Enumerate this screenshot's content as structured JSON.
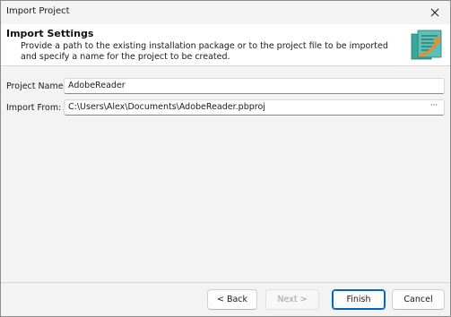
{
  "window": {
    "title": "Import Project",
    "close_icon": "close-icon"
  },
  "header": {
    "title": "Import Settings",
    "description": "Provide a path to the existing installation package or to the project file to be imported and specify a name for the project to be created.",
    "graphic_icon": "import-wizard-icon"
  },
  "form": {
    "project_name_label": "Project Name:",
    "project_name_value": "AdobeReader",
    "import_from_label": "Import From:",
    "import_from_value": "C:\\Users\\Alex\\Documents\\AdobeReader.pbproj",
    "browse_label": "···"
  },
  "buttons": {
    "back": "< Back",
    "next": "Next >",
    "finish": "Finish",
    "cancel": "Cancel"
  },
  "colors": {
    "accent": "#0067c0",
    "icon_teal": "#2aa39b",
    "icon_orange": "#f08a24"
  }
}
